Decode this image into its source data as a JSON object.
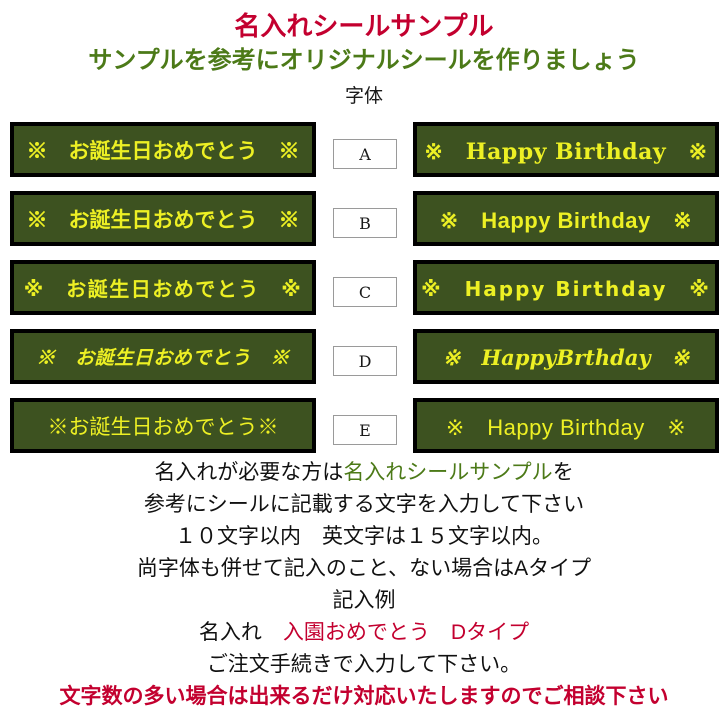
{
  "header": {
    "title_main": "名入れシールサンプル",
    "title_sub": "サンプルを参考にオリジナルシールを作りましょう",
    "column_label": "字体"
  },
  "colors": {
    "title_red": "#c3002f",
    "title_green": "#4c7a18",
    "sticker_bg_green": "#3d5220",
    "sticker_border_black": "#000000",
    "sticker_text_yellow": "#edf024",
    "body_text": "#111111"
  },
  "samples": [
    {
      "code": "A",
      "japanese": "※　お誕生日おめでとう　※",
      "english": "※　Happy Birthday　※"
    },
    {
      "code": "B",
      "japanese": "※　お誕生日おめでとう　※",
      "english": "※　Happy Birthday　※"
    },
    {
      "code": "C",
      "japanese": "※　お誕生日おめでとう　※",
      "english": "※　Happy Birthday　※"
    },
    {
      "code": "D",
      "japanese": "※　お誕生日おめでとう　※",
      "english": "※　HappyBrthday　※"
    },
    {
      "code": "E",
      "japanese": "※お誕生日おめでとう※",
      "english": "※　Happy Birthday　※"
    }
  ],
  "footer": {
    "line1_a": "名入れが必要な方は",
    "line1_b": "名入れシールサンプル",
    "line1_c": "を",
    "line2": "参考にシールに記載する文字を入力して下さい",
    "line3": "１０文字以内　英文字は１５文字以内。",
    "line4": "尚字体も併せて記入のこと、ない場合はAタイプ",
    "line5": "記入例",
    "line6_a": "名入れ　",
    "line6_b": "入園おめでとう　Dタイプ",
    "line7": "ご注文手続きで入力して下さい。",
    "line8": "文字数の多い場合は出来るだけ対応いたしますのでご相談下さい"
  }
}
